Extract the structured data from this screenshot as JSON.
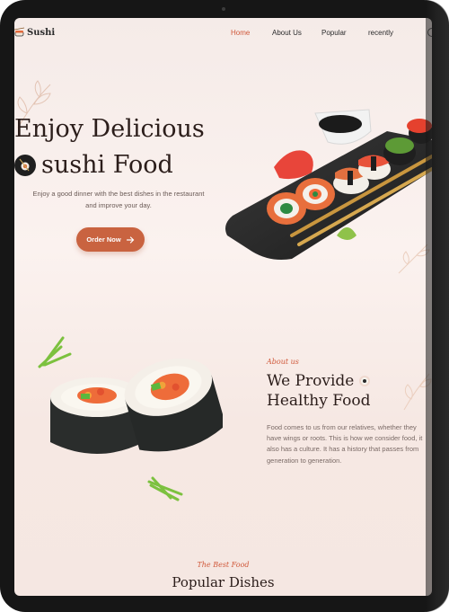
{
  "brand": {
    "name": "Sushi"
  },
  "nav": {
    "items": [
      {
        "label": "Home",
        "active": true
      },
      {
        "label": "About Us",
        "active": false
      },
      {
        "label": "Popular",
        "active": false
      },
      {
        "label": "recently",
        "active": false
      }
    ]
  },
  "hero": {
    "title_line1": "Enjoy Delicious",
    "title_line2": "sushi Food",
    "description": "Enjoy a good dinner with the best dishes in the restaurant and improve your day.",
    "cta_label": "Order Now"
  },
  "about": {
    "kicker": "About us",
    "title_line1": "We Provide",
    "title_line2": "Healthy Food",
    "text": "Food comes to us from our relatives, whether they have wings or roots. This is how we consider food, it also has a culture. It has a history that passes from generation to generation."
  },
  "popular": {
    "kicker": "The Best Food",
    "title": "Popular Dishes"
  },
  "colors": {
    "accent": "#d0583a",
    "button": "#c96340",
    "text_dark": "#2b1d1a",
    "background": "#f7ece8"
  },
  "icons": [
    "sushi-logo-icon",
    "chopsticks-sushi-icon",
    "arrow-right-icon",
    "search-icon",
    "sushi-roll-icon"
  ]
}
